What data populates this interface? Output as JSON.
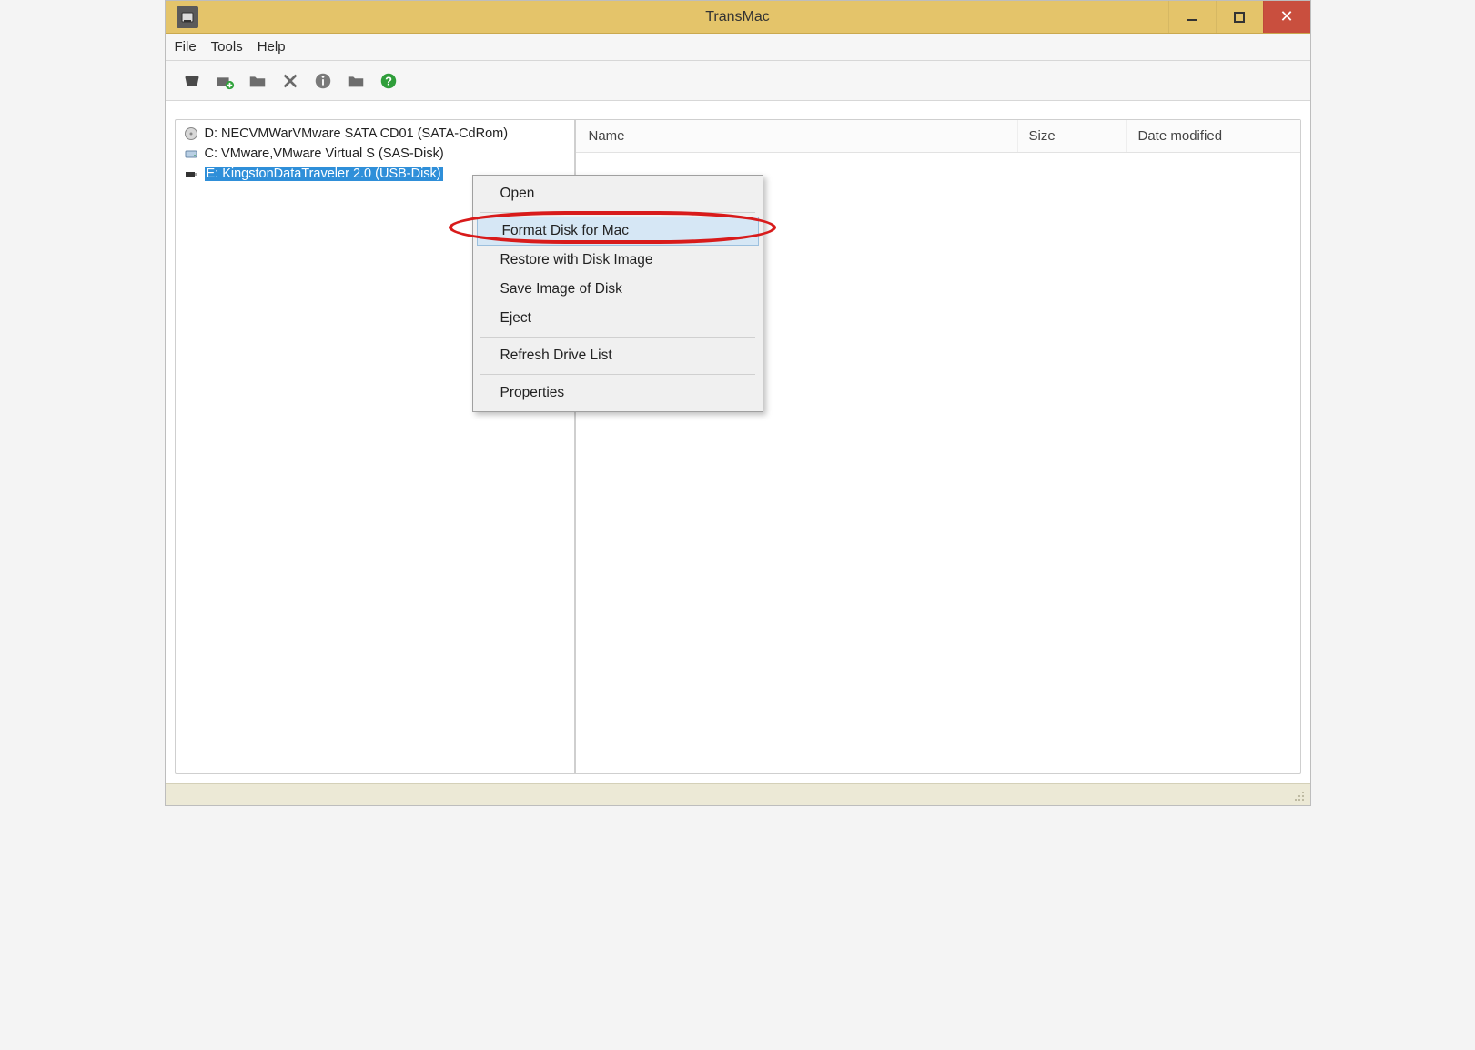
{
  "window": {
    "title": "TransMac"
  },
  "menubar": {
    "file": "File",
    "tools": "Tools",
    "help": "Help"
  },
  "tree": {
    "items": [
      {
        "label": "D: NECVMWarVMware SATA CD01 (SATA-CdRom)",
        "icon": "disc"
      },
      {
        "label": "C: VMware,VMware Virtual S (SAS-Disk)",
        "icon": "hdd"
      },
      {
        "label": "E: KingstonDataTraveler 2.0 (USB-Disk)",
        "icon": "usb",
        "selected": true
      }
    ]
  },
  "list_headers": {
    "name": "Name",
    "size": "Size",
    "date": "Date modified"
  },
  "context_menu": {
    "open": "Open",
    "format": "Format Disk for Mac",
    "restore": "Restore with Disk Image",
    "save_image": "Save Image of Disk",
    "eject": "Eject",
    "refresh": "Refresh Drive List",
    "properties": "Properties"
  },
  "colors": {
    "titlebar_bg": "#e4c46a",
    "close_bg": "#c94f3e",
    "selection_bg": "#2f8fd9",
    "menu_hover_bg": "#d6e7f5",
    "annotation": "#d81b1b"
  }
}
